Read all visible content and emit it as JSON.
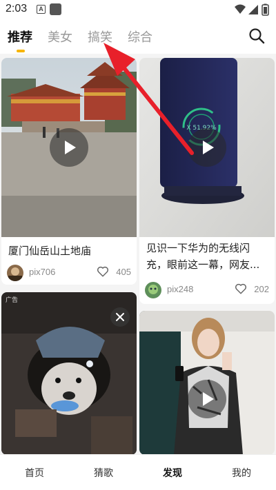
{
  "status_bar": {
    "time": "2:03",
    "notification_letter": "A"
  },
  "top_tabs": [
    {
      "label": "推荐",
      "active": true
    },
    {
      "label": "美女",
      "active": false
    },
    {
      "label": "搞笑",
      "active": false
    },
    {
      "label": "综合",
      "active": false
    }
  ],
  "cards": [
    {
      "title": "厦门仙岳山土地庙",
      "author": "pix706",
      "likes": "405"
    },
    {
      "title_line1": "见识一下华为的无线闪",
      "title_line2": "充，眼前这一幕，网友...",
      "author": "pix248",
      "likes": "202",
      "overlay_text": "X 51.92%"
    },
    {
      "ad_badge": "广告"
    },
    {}
  ],
  "bottom_nav": [
    {
      "label": "首页",
      "active": false
    },
    {
      "label": "猜歌",
      "active": false
    },
    {
      "label": "发现",
      "active": true
    },
    {
      "label": "我的",
      "active": false
    }
  ],
  "colors": {
    "accent": "#f7b500",
    "annotation": "#e8202a"
  }
}
